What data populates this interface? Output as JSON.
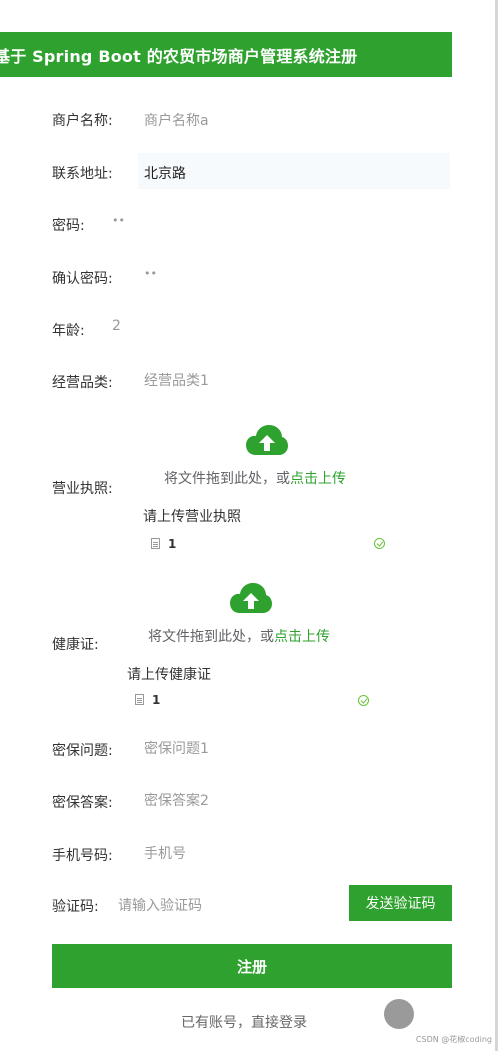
{
  "header": {
    "title": "基于 Spring Boot 的农贸市场商户管理系统注册"
  },
  "form": {
    "merchant_name": {
      "label": "商户名称:",
      "placeholder": "商户名称a"
    },
    "address": {
      "label": "联系地址:",
      "value": "北京路"
    },
    "password": {
      "label": "密码:",
      "value": "••"
    },
    "confirm_password": {
      "label": "确认密码:",
      "value": "••"
    },
    "age": {
      "label": "年龄:",
      "value": "2"
    },
    "category": {
      "label": "经营品类:",
      "placeholder": "经营品类1"
    },
    "license": {
      "label": "营业执照:",
      "upload_text": "将文件拖到此处，或",
      "upload_link": "点击上传",
      "hint": "请上传营业执照",
      "file_name": "1"
    },
    "health": {
      "label": "健康证:",
      "upload_text": "将文件拖到此处，或",
      "upload_link": "点击上传",
      "hint": "请上传健康证",
      "file_name": "1"
    },
    "security_question": {
      "label": "密保问题:",
      "placeholder": "密保问题1"
    },
    "security_answer": {
      "label": "密保答案:",
      "placeholder": "密保答案2"
    },
    "phone": {
      "label": "手机号码:",
      "placeholder": "手机号"
    },
    "code": {
      "label": "验证码:",
      "placeholder": "请输入验证码",
      "send_label": "发送验证码"
    }
  },
  "actions": {
    "register_label": "注册",
    "login_link": "已有账号，直接登录"
  },
  "watermark": "CSDN @花椒coding",
  "colors": {
    "accent": "#2ea12e",
    "success": "#67c23a",
    "placeholder": "#999999"
  },
  "icons": {
    "upload": "cloud-upload-icon",
    "file": "document-icon",
    "status": "check-circle-icon"
  }
}
